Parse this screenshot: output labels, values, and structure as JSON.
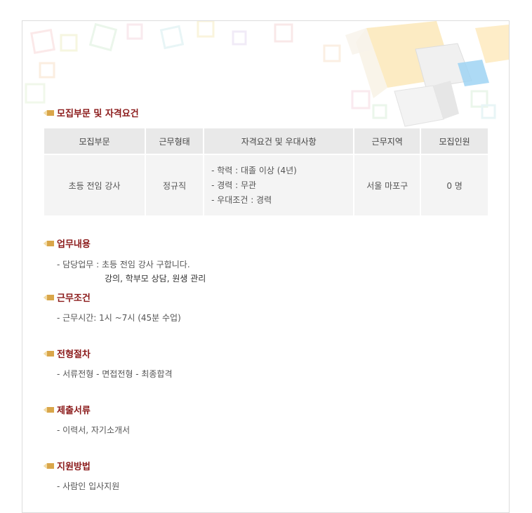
{
  "sections": {
    "recruit": "모집부문 및 자격요건",
    "duty": "업무내용",
    "condition": "근무조건",
    "process": "전형절차",
    "documents": "제출서류",
    "apply": "지원방법"
  },
  "table": {
    "headers": [
      "모집부문",
      "근무형태",
      "자격요건 및 우대사항",
      "근무지역",
      "모집인원"
    ],
    "row": {
      "position": "초등 전임 강사",
      "type": "정규직",
      "qualifications": [
        "- 학력 : 대졸 이상 (4년)",
        "- 경력 : 무관",
        "- 우대조건 : 경력"
      ],
      "location": "서울 마포구",
      "count": "0 명"
    }
  },
  "duty": {
    "line1": "- 담당업무 : 초등 전임 강사 구합니다.",
    "line2": "강의, 학부모 상담, 원생 관리"
  },
  "condition": {
    "line1": "- 근무시간: 1시 ~7시 (45분 수업)"
  },
  "process": {
    "line1": "- 서류전형 - 면접전형 - 최종합격"
  },
  "documents": {
    "line1": "- 이력서, 자기소개서"
  },
  "apply": {
    "line1": "- 사람인 입사지원"
  },
  "colors": {
    "title": "#8b1a1a",
    "header_bg": "#e9e9e9",
    "cell_bg": "#f4f4f4"
  }
}
